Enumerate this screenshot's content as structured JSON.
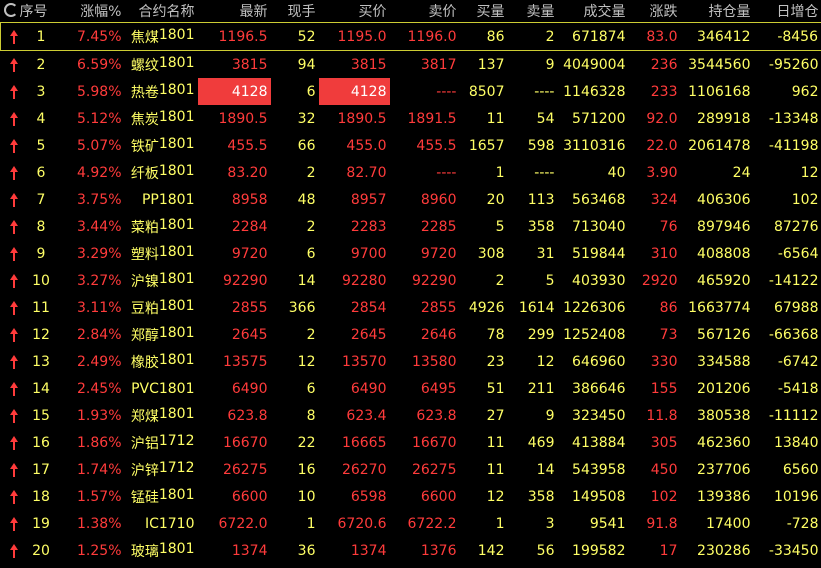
{
  "headers": [
    "序号",
    "涨幅%",
    "合约名称",
    "最新",
    "现手",
    "买价",
    "卖价",
    "买量",
    "卖量",
    "成交量",
    "涨跌",
    "持仓量",
    "日增仓"
  ],
  "rows": [
    [
      "1",
      "7.45%",
      "焦煤",
      "1801",
      "1196.5",
      "52",
      "1195.0",
      "1196.0",
      "86",
      "2",
      "671874",
      "83.0",
      "346412",
      "-8456"
    ],
    [
      "2",
      "6.59%",
      "螺纹",
      "1801",
      "3815",
      "94",
      "3815",
      "3817",
      "137",
      "9",
      "4049004",
      "236",
      "3544560",
      "-95260"
    ],
    [
      "3",
      "5.98%",
      "热卷",
      "1801",
      "4128",
      "6",
      "4128",
      "----",
      "8507",
      "----",
      "1146328",
      "233",
      "1106168",
      "962"
    ],
    [
      "4",
      "5.12%",
      "焦炭",
      "1801",
      "1890.5",
      "32",
      "1890.5",
      "1891.5",
      "11",
      "54",
      "571200",
      "92.0",
      "289918",
      "-13348"
    ],
    [
      "5",
      "5.07%",
      "铁矿",
      "1801",
      "455.5",
      "66",
      "455.0",
      "455.5",
      "1657",
      "598",
      "3110316",
      "22.0",
      "2061478",
      "-41198"
    ],
    [
      "6",
      "4.92%",
      "纤板",
      "1801",
      "83.20",
      "2",
      "82.70",
      "----",
      "1",
      "----",
      "40",
      "3.90",
      "24",
      "12"
    ],
    [
      "7",
      "3.75%",
      "PP",
      "1801",
      "8958",
      "48",
      "8957",
      "8960",
      "20",
      "113",
      "563468",
      "324",
      "406306",
      "102"
    ],
    [
      "8",
      "3.44%",
      "菜粕",
      "1801",
      "2284",
      "2",
      "2283",
      "2285",
      "5",
      "358",
      "713040",
      "76",
      "897946",
      "87276"
    ],
    [
      "9",
      "3.29%",
      "塑料",
      "1801",
      "9720",
      "6",
      "9700",
      "9720",
      "308",
      "31",
      "519844",
      "310",
      "408808",
      "-6564"
    ],
    [
      "10",
      "3.27%",
      "沪镍",
      "1801",
      "92290",
      "14",
      "92280",
      "92290",
      "2",
      "5",
      "403930",
      "2920",
      "465920",
      "-14122"
    ],
    [
      "11",
      "3.11%",
      "豆粕",
      "1801",
      "2855",
      "366",
      "2854",
      "2855",
      "4926",
      "1614",
      "1226306",
      "86",
      "1663774",
      "67988"
    ],
    [
      "12",
      "2.84%",
      "郑醇",
      "1801",
      "2645",
      "2",
      "2645",
      "2646",
      "78",
      "299",
      "1252408",
      "73",
      "567126",
      "-66368"
    ],
    [
      "13",
      "2.49%",
      "橡胶",
      "1801",
      "13575",
      "12",
      "13570",
      "13580",
      "23",
      "12",
      "646960",
      "330",
      "334588",
      "-6742"
    ],
    [
      "14",
      "2.45%",
      "PVC",
      "1801",
      "6490",
      "6",
      "6490",
      "6495",
      "51",
      "211",
      "386646",
      "155",
      "201206",
      "-5418"
    ],
    [
      "15",
      "1.93%",
      "郑煤",
      "1801",
      "623.8",
      "8",
      "623.4",
      "623.8",
      "27",
      "9",
      "323450",
      "11.8",
      "380538",
      "-11112"
    ],
    [
      "16",
      "1.86%",
      "沪铝",
      "1712",
      "16670",
      "22",
      "16665",
      "16670",
      "11",
      "469",
      "413884",
      "305",
      "462360",
      "13840"
    ],
    [
      "17",
      "1.74%",
      "沪锌",
      "1712",
      "26275",
      "16",
      "26270",
      "26275",
      "11",
      "14",
      "543958",
      "450",
      "237706",
      "6560"
    ],
    [
      "18",
      "1.57%",
      "锰硅",
      "1801",
      "6600",
      "10",
      "6598",
      "6600",
      "12",
      "358",
      "149508",
      "102",
      "139386",
      "10196"
    ],
    [
      "19",
      "1.38%",
      "IC",
      "1710",
      "6722.0",
      "1",
      "6720.6",
      "6722.2",
      "1",
      "3",
      "9541",
      "91.8",
      "17400",
      "-728"
    ],
    [
      "20",
      "1.25%",
      "玻璃",
      "1801",
      "1374",
      "36",
      "1374",
      "1376",
      "142",
      "56",
      "199582",
      "17",
      "230286",
      "-33450"
    ]
  ],
  "highlighted": [
    {
      "row": 2,
      "cols": [
        4,
        6
      ]
    }
  ],
  "colors": {
    "up": "#ff3b3b",
    "neutral": "#ffff66",
    "header": "#c0c0c0",
    "highlight": "#f03c3c",
    "selection": "#cccc33"
  },
  "icons": {
    "header_refresh": "refresh-icon",
    "row_trend": "up-arrow-icon"
  }
}
